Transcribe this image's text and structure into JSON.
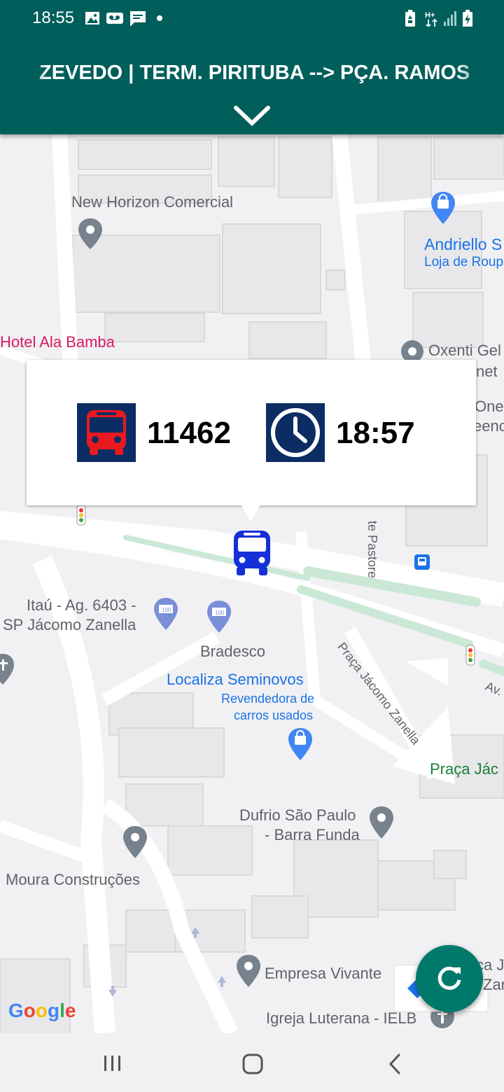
{
  "status_bar": {
    "time": "18:55",
    "left_icons": [
      "image-icon",
      "voicemail-icon",
      "message-icon",
      "dot-icon"
    ],
    "right_icons": [
      "battery-saver-icon",
      "network-h-plus-icon",
      "signal-icon",
      "battery-charging-icon"
    ]
  },
  "app_bar": {
    "route_title": "ZEVEDO | TERM. PIRITUBA --> PÇA. RAMOS",
    "expand_icon": "chevron-down-icon"
  },
  "map": {
    "labels": [
      {
        "name": "new-horizon",
        "text": "New Horizon Comercial"
      },
      {
        "name": "andriello",
        "text": "Andriello S"
      },
      {
        "name": "andriello-sub",
        "text": "Loja de Roupa"
      },
      {
        "name": "hotel",
        "text": "Hotel Ala Bamba"
      },
      {
        "name": "oxenti",
        "text": "Oxenti Gel"
      },
      {
        "name": "oxenti-2",
        "text": "net"
      },
      {
        "name": "one",
        "text": "One"
      },
      {
        "name": "one-2",
        "text": "eenc"
      },
      {
        "name": "pastore",
        "text": "te Pastore"
      },
      {
        "name": "itau-1",
        "text": "Itaú - Ag. 6403 -"
      },
      {
        "name": "itau-2",
        "text": "SP Jácomo Zanella"
      },
      {
        "name": "bradesco",
        "text": "Bradesco"
      },
      {
        "name": "localiza",
        "text": "Localiza Seminovos"
      },
      {
        "name": "localiza-sub-1",
        "text": "Revendedora de"
      },
      {
        "name": "localiza-sub-2",
        "text": "carros usados"
      },
      {
        "name": "praca-street",
        "text": "Praça Jácomo Zanella"
      },
      {
        "name": "praca-jac",
        "text": "Praça Jác"
      },
      {
        "name": "av",
        "text": "Av."
      },
      {
        "name": "dufrio-1",
        "text": "Dufrio São Paulo"
      },
      {
        "name": "dufrio-2",
        "text": "- Barra Funda"
      },
      {
        "name": "moura",
        "text": "Moura Construções"
      },
      {
        "name": "empresa",
        "text": "Empresa Vivante"
      },
      {
        "name": "igreja",
        "text": "Igreja Luterana - IELB"
      },
      {
        "name": "ca-1",
        "text": "ca J"
      },
      {
        "name": "ca-2",
        "text": "Zan"
      }
    ],
    "watermark": "Google"
  },
  "info_card": {
    "vehicle_icon": "bus-icon",
    "vehicle_id": "11462",
    "time_icon": "clock-icon",
    "arrival_time": "18:57"
  },
  "fab": {
    "icon": "refresh-icon"
  },
  "nav_bar": {
    "icons": [
      "recent-apps-icon",
      "home-icon",
      "back-icon"
    ]
  },
  "colors": {
    "app_bar": "#005f5b",
    "fab": "#00796b",
    "tile": "#0c2c64",
    "bus_red": "#e8191f",
    "bus_marker": "#1530d8"
  }
}
